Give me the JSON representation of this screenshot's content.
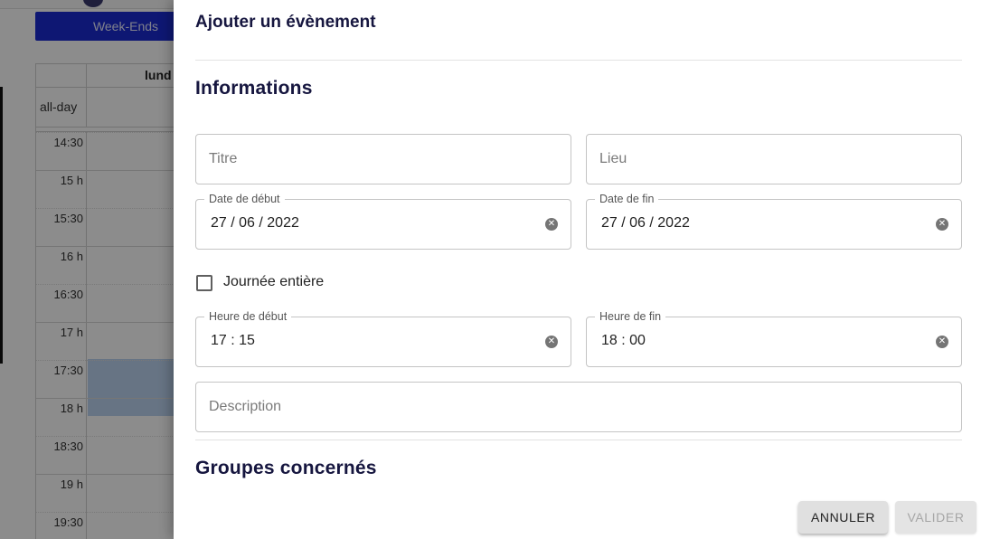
{
  "calendar": {
    "weekends_button": "Week-Ends",
    "day_header": "lund",
    "allday_label": "all-day",
    "time_labels": [
      "14:30",
      "15 h",
      "15:30",
      "16 h",
      "16:30",
      "17 h",
      "17:30",
      "18 h",
      "18:30",
      "19 h",
      "19:30"
    ]
  },
  "dialog": {
    "title": "Ajouter un évènement",
    "section_informations": "Informations",
    "section_groupes": "Groupes concernés",
    "fields": {
      "titre_placeholder": "Titre",
      "lieu_placeholder": "Lieu",
      "date_debut_label": "Date de début",
      "date_debut_value": "27 / 06 / 2022",
      "date_fin_label": "Date de fin",
      "date_fin_value": "27 / 06 / 2022",
      "journee_entiere_label": "Journée entière",
      "journee_entiere_checked": false,
      "heure_debut_label": "Heure de début",
      "heure_debut_value": "17 : 15",
      "heure_fin_label": "Heure de fin",
      "heure_fin_value": "18 : 00",
      "description_placeholder": "Description"
    },
    "buttons": {
      "cancel": "ANNULER",
      "submit": "VALIDER"
    },
    "colors": {
      "title": "#16163f",
      "weekends_button": "#1a2bd1"
    }
  }
}
